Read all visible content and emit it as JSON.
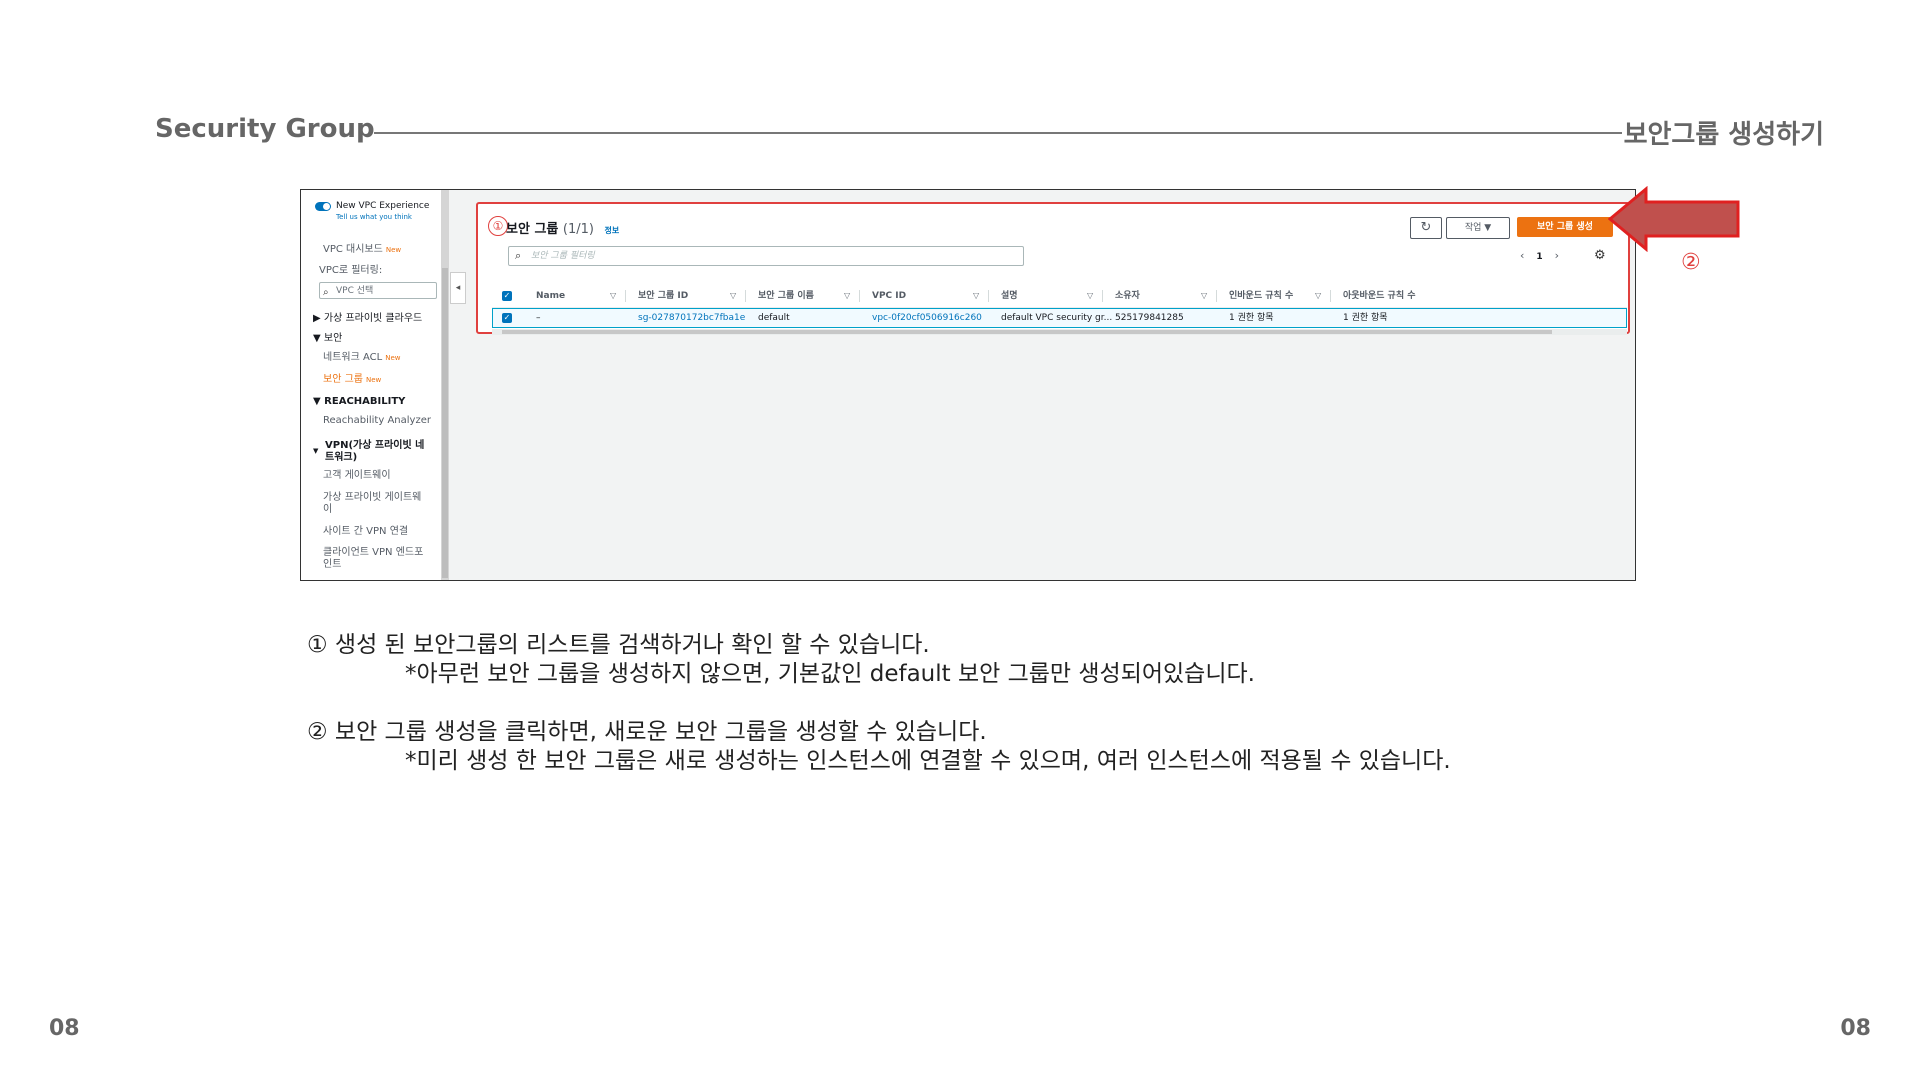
{
  "slide": {
    "title": "Security Group",
    "subtitle": "보안그룹 생성하기",
    "page_left": "08",
    "page_right": "08"
  },
  "sidebar": {
    "toggle_label": "New VPC Experience",
    "toggle_sub": "Tell us what you think",
    "vpc_dashboard": "VPC 대시보드",
    "new_tag": "New",
    "filter_label": "VPC로 필터링:",
    "vpc_select_placeholder": "VPC 선택",
    "private_cloud": "▶ 가상 프라이빗 클라우드",
    "security": "▼ 보안",
    "network_acl": "네트워크 ACL",
    "security_groups": "보안 그룹",
    "reachability": "▼ REACHABILITY",
    "reachability_analyzer": "Reachability Analyzer",
    "vpn_section_1": "VPN(가상 프라이빗 네",
    "vpn_section_2": "트워크)",
    "customer_gateway": "고객 게이트웨이",
    "vpg_1": "가상 프라이빗 게이트웨",
    "vpg_2": "이",
    "site_vpn": "사이트 간 VPN 연결",
    "client_vpn_1": "클라이언트 VPN 엔드포",
    "client_vpn_2": "인트"
  },
  "panel": {
    "marker": "①",
    "title": "보안 그룹",
    "count": "(1/1)",
    "info_link": "정보",
    "refresh_icon": "refresh-icon",
    "action_button": "작업 ▼",
    "create_button": "보안 그룹 생성",
    "filter_placeholder": "보안 그룹 필터링",
    "page_current": "1",
    "page_prev": "‹",
    "page_next": "›"
  },
  "table": {
    "headers": [
      "Name",
      "보안 그룹 ID",
      "보안 그룹 이름",
      "VPC ID",
      "설명",
      "소유자",
      "인바운드 규칙 수",
      "아웃바운드 규칙 수"
    ],
    "rows": [
      {
        "selected": true,
        "name": "–",
        "group_id": "sg-027870172bc7fba1e",
        "group_name": "default",
        "vpc_id": "vpc-0f20cf0506916c260",
        "description": "default VPC security gr...",
        "owner": "525179841285",
        "inbound": "1 권한 항목",
        "outbound": "1 권한 항목"
      }
    ]
  },
  "annotation": {
    "marker_2": "②",
    "arrow_color": "#c0504d"
  },
  "notes": {
    "line1": "① 생성 된 보안그룹의 리스트를 검색하거나 확인 할 수 있습니다.",
    "line1_sub": "*아무런 보안 그룹을 생성하지 않으면, 기본값인 default 보안 그룹만 생성되어있습니다.",
    "line2": "② 보안 그룹 생성을 클릭하면, 새로운 보안 그룹을 생성할 수 있습니다.",
    "line2_sub": "*미리 생성 한 보안 그룹은 새로 생성하는 인스턴스에 연결할 수 있으며, 여러 인스턴스에 적용될 수 있습니다."
  }
}
